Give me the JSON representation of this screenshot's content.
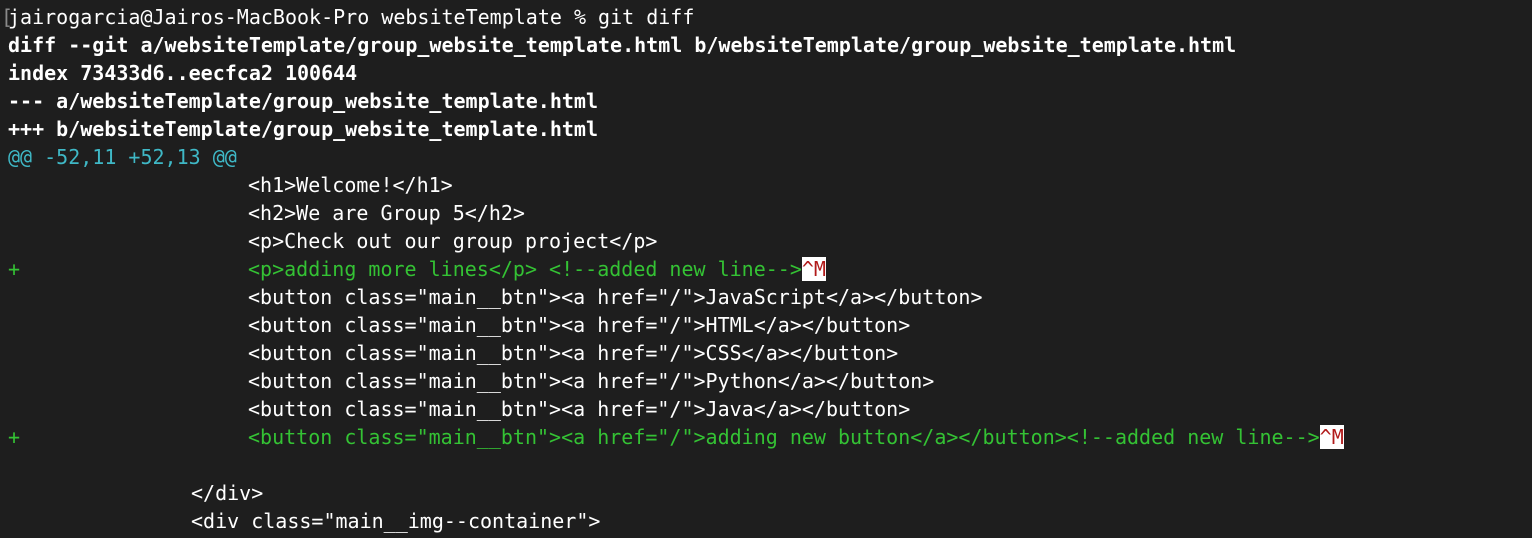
{
  "prompt": {
    "user_host": "jairogarcia@Jairos-MacBook-Pro",
    "cwd": "websiteTemplate",
    "symbol": "%",
    "command": "git diff"
  },
  "diff_header": {
    "diff_line": "diff --git a/websiteTemplate/group_website_template.html b/websiteTemplate/group_website_template.html",
    "index_line": "index 73433d6..eecfca2 100644",
    "minus_line": "--- a/websiteTemplate/group_website_template.html",
    "plus_line": "+++ b/websiteTemplate/group_website_template.html"
  },
  "hunk_header": "@@ -52,11 +52,13 @@",
  "lines": [
    {
      "type": "context",
      "text": "<h1>Welcome!</h1>"
    },
    {
      "type": "context",
      "text": "<h2>We are Group 5</h2>"
    },
    {
      "type": "context",
      "text": "<p>Check out our group project</p>"
    },
    {
      "type": "added",
      "marker": "+",
      "text": "<p>adding more lines</p> <!--added new line-->",
      "ctrl": "^M"
    },
    {
      "type": "context",
      "text": "<button class=\"main__btn\"><a href=\"/\">JavaScript</a></button>"
    },
    {
      "type": "context",
      "text": "<button class=\"main__btn\"><a href=\"/\">HTML</a></button>"
    },
    {
      "type": "context",
      "text": "<button class=\"main__btn\"><a href=\"/\">CSS</a></button>"
    },
    {
      "type": "context",
      "text": "<button class=\"main__btn\"><a href=\"/\">Python</a></button>"
    },
    {
      "type": "context",
      "text": "<button class=\"main__btn\"><a href=\"/\">Java</a></button>"
    },
    {
      "type": "added",
      "marker": "+",
      "text": "<button class=\"main__btn\"><a href=\"/\">adding new button</a></button><!--added new line-->",
      "ctrl": "^M"
    },
    {
      "type": "blank",
      "text": ""
    },
    {
      "type": "outer",
      "text": "</div>"
    },
    {
      "type": "outer",
      "text": "<div class=\"main__img--container\">"
    }
  ],
  "colors": {
    "background": "#1e1e1e",
    "text": "#ffffff",
    "hunk": "#3fb8c6",
    "added": "#34c234",
    "ctrl_bg": "#ffffff",
    "ctrl_fg": "#b11a1a"
  }
}
